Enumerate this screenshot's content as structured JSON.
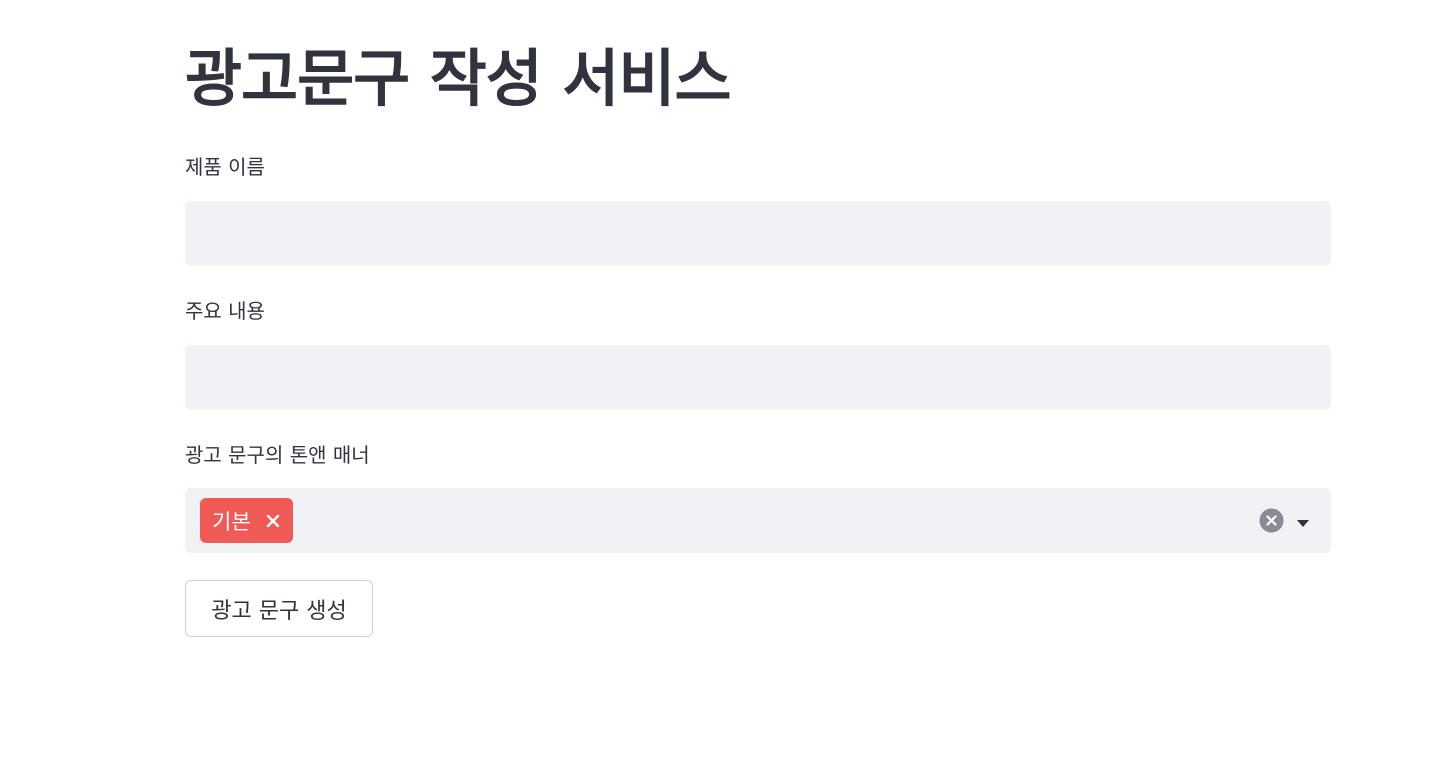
{
  "page": {
    "title": "광고문구 작성 서비스"
  },
  "form": {
    "product_name": {
      "label": "제품 이름",
      "value": "",
      "placeholder": ""
    },
    "main_content": {
      "label": "주요 내용",
      "value": "",
      "placeholder": ""
    },
    "tone_manner": {
      "label": "광고 문구의 톤앤 매너",
      "selected": [
        "기본"
      ],
      "tag_color": "#ef5a57",
      "clear_icon": "clear-circle-x-icon",
      "dropdown_icon": "caret-down-icon"
    },
    "submit_label": "광고 문구 생성"
  },
  "colors": {
    "input_bg": "#f0f2f6",
    "text": "#31333f",
    "accent": "#ef5a57"
  }
}
